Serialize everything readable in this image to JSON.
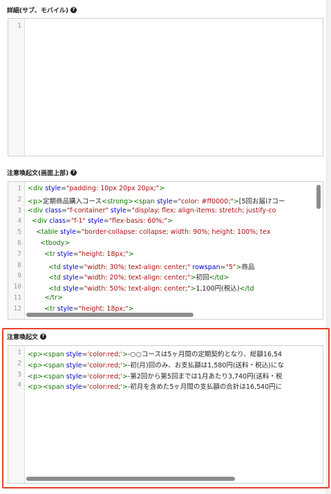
{
  "sections": {
    "detail": {
      "label": "詳細(サブ、モバイル)",
      "line_numbers": [
        "1"
      ]
    },
    "notice_top": {
      "label": "注意喚起文(画面上部)",
      "line_numbers": [
        "1",
        "2",
        "3",
        "4",
        "5",
        "6",
        "7",
        "8",
        "9",
        "10",
        "11",
        "12"
      ]
    },
    "notice": {
      "label": "注意喚起文",
      "line_numbers": [
        "1",
        "2",
        "3",
        "4"
      ]
    }
  },
  "code_top": [
    [
      [
        "t",
        "<div "
      ],
      [
        "a",
        "style"
      ],
      [
        "p",
        "="
      ],
      [
        "s",
        "\"padding: 10px 20px 20px;\""
      ],
      [
        "t",
        ">"
      ]
    ],
    [
      [
        "t",
        "<p>"
      ],
      [
        "p",
        "定期商品購入コース"
      ],
      [
        "t",
        "<strong><span "
      ],
      [
        "a",
        "style"
      ],
      [
        "p",
        "="
      ],
      [
        "s",
        "\"color: #ff0000;\""
      ],
      [
        "t",
        ">"
      ],
      [
        "p",
        "[5回お届けコー"
      ]
    ],
    [
      [
        "t",
        "<div "
      ],
      [
        "a",
        "class"
      ],
      [
        "p",
        "="
      ],
      [
        "s",
        "\"f-container\""
      ],
      [
        "p",
        " "
      ],
      [
        "a",
        "style"
      ],
      [
        "p",
        "="
      ],
      [
        "s",
        "\"display: flex; align-items: stretch; justify-co"
      ]
    ],
    [
      [
        "p",
        "  "
      ],
      [
        "t",
        "<div "
      ],
      [
        "a",
        "class"
      ],
      [
        "p",
        "="
      ],
      [
        "s",
        "\"f-1\""
      ],
      [
        "p",
        " "
      ],
      [
        "a",
        "style"
      ],
      [
        "p",
        "="
      ],
      [
        "s",
        "\"flex-basis: 60%;\""
      ],
      [
        "t",
        ">"
      ]
    ],
    [
      [
        "p",
        "    "
      ],
      [
        "t",
        "<table "
      ],
      [
        "a",
        "style"
      ],
      [
        "p",
        "="
      ],
      [
        "s",
        "\"border-collapse: collapse; width: 90%; height: 100%; tex"
      ]
    ],
    [
      [
        "p",
        "      "
      ],
      [
        "t",
        "<tbody>"
      ]
    ],
    [
      [
        "p",
        "        "
      ],
      [
        "t",
        "<tr "
      ],
      [
        "a",
        "style"
      ],
      [
        "p",
        "="
      ],
      [
        "s",
        "\"height: 18px;\""
      ],
      [
        "t",
        ">"
      ]
    ],
    [
      [
        "p",
        "          "
      ],
      [
        "t",
        "<td "
      ],
      [
        "a",
        "style"
      ],
      [
        "p",
        "="
      ],
      [
        "s",
        "\"width: 30%; text-align: center;\""
      ],
      [
        "p",
        " "
      ],
      [
        "a",
        "rowspan"
      ],
      [
        "p",
        "="
      ],
      [
        "s",
        "\"5\""
      ],
      [
        "t",
        ">"
      ],
      [
        "p",
        "商品"
      ]
    ],
    [
      [
        "p",
        "          "
      ],
      [
        "t",
        "<td "
      ],
      [
        "a",
        "style"
      ],
      [
        "p",
        "="
      ],
      [
        "s",
        "\"width: 20%; text-align: center;\""
      ],
      [
        "t",
        ">"
      ],
      [
        "p",
        "初回"
      ],
      [
        "t",
        "</td>"
      ]
    ],
    [
      [
        "p",
        "          "
      ],
      [
        "t",
        "<td "
      ],
      [
        "a",
        "style"
      ],
      [
        "p",
        "="
      ],
      [
        "s",
        "\"width: 50%; text-align: center;\""
      ],
      [
        "t",
        ">"
      ],
      [
        "p",
        "1,100円(税込)"
      ],
      [
        "t",
        "</td"
      ]
    ],
    [
      [
        "p",
        "        "
      ],
      [
        "t",
        "</tr>"
      ]
    ],
    [
      [
        "p",
        "        "
      ],
      [
        "t",
        "<tr "
      ],
      [
        "a",
        "style"
      ],
      [
        "p",
        "="
      ],
      [
        "s",
        "\"height: 18px;\""
      ],
      [
        "t",
        ">"
      ]
    ]
  ],
  "code_bottom": [
    [
      [
        "t",
        "<p><span "
      ],
      [
        "a",
        "style"
      ],
      [
        "p",
        "="
      ],
      [
        "s",
        "'color:red;'"
      ],
      [
        "t",
        ">"
      ],
      [
        "p",
        "-○○コースは5ヶ月間の定期契約となり、総額16,54"
      ]
    ],
    [
      [
        "t",
        "<p><span "
      ],
      [
        "a",
        "style"
      ],
      [
        "p",
        "="
      ],
      [
        "s",
        "'color:red;'"
      ],
      [
        "t",
        ">"
      ],
      [
        "p",
        "-初(月)回のみ、お支払額は1,580円(送料・税込)にな"
      ]
    ],
    [
      [
        "t",
        "<p><span "
      ],
      [
        "a",
        "style"
      ],
      [
        "p",
        "="
      ],
      [
        "s",
        "'color:red;'"
      ],
      [
        "t",
        ">"
      ],
      [
        "p",
        "-第2回から第5回までは1月あたり3,740円(送料・税"
      ]
    ],
    [
      [
        "t",
        "<p><span "
      ],
      [
        "a",
        "style"
      ],
      [
        "p",
        "="
      ],
      [
        "s",
        "'color:red;'"
      ],
      [
        "t",
        ">"
      ],
      [
        "p",
        "-初月を含めた5ヶ月間の支払額の合計は16,540円に"
      ]
    ]
  ]
}
